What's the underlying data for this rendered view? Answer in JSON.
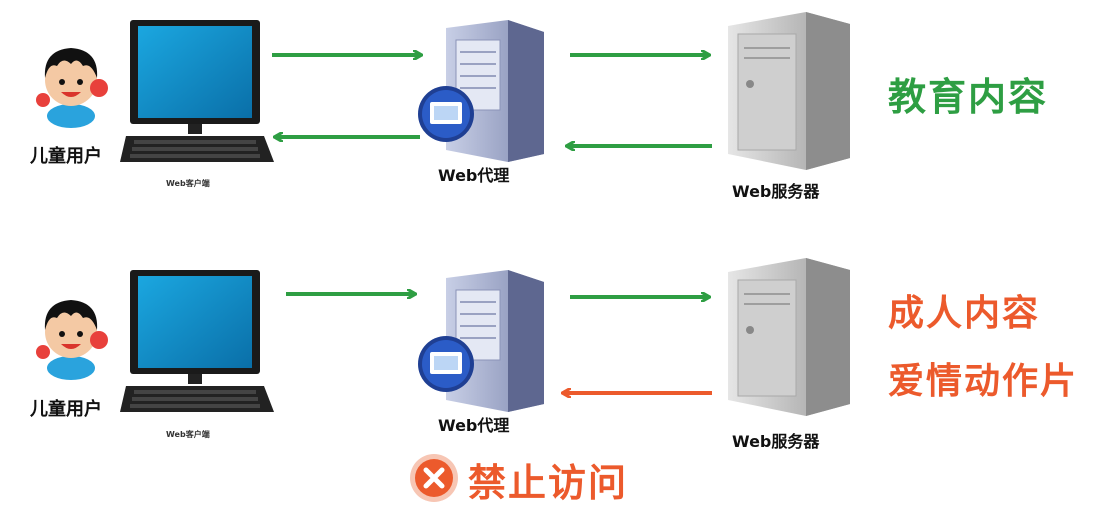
{
  "colors": {
    "green": "#2e9e43",
    "red": "#ec5a2c"
  },
  "rows": [
    {
      "user_label": "儿童用户",
      "client_label": "Web客户端",
      "proxy_label": "Web代理",
      "server_label": "Web服务器",
      "content_lines": [
        "教育内容"
      ],
      "content_color": "green",
      "return_color": "green"
    },
    {
      "user_label": "儿童用户",
      "client_label": "Web客户端",
      "proxy_label": "Web代理",
      "server_label": "Web服务器",
      "content_lines": [
        "成人内容",
        "爱情动作片"
      ],
      "content_color": "red",
      "return_color": "red",
      "blocked_label": "禁止访问"
    }
  ]
}
